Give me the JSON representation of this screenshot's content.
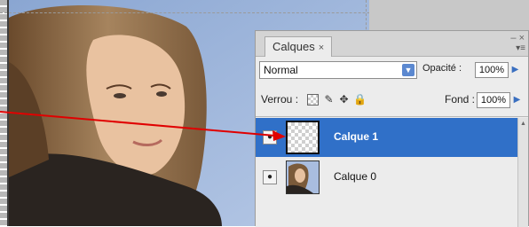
{
  "panel": {
    "tab_label": "Calques",
    "tab_close": "×",
    "window_controls": "– ×",
    "menu_icon": "panel-menu-icon"
  },
  "blend": {
    "mode_value": "Normal",
    "opacity_label": "Opacité :",
    "opacity_value": "100%"
  },
  "lock": {
    "label": "Verrou :",
    "fill_label": "Fond :",
    "fill_value": "100%",
    "icons": [
      "lock-transparent-icon",
      "lock-paint-icon",
      "lock-move-icon",
      "lock-all-icon"
    ]
  },
  "layers": [
    {
      "name": "Calque 1",
      "selected": true,
      "thumbnail": "transparent"
    },
    {
      "name": "Calque 0",
      "selected": false,
      "thumbnail": "photo"
    }
  ],
  "colors": {
    "selection": "#3070c8",
    "annotation_arrow": "#e00000",
    "photo_sky": "#9fb7dc"
  }
}
